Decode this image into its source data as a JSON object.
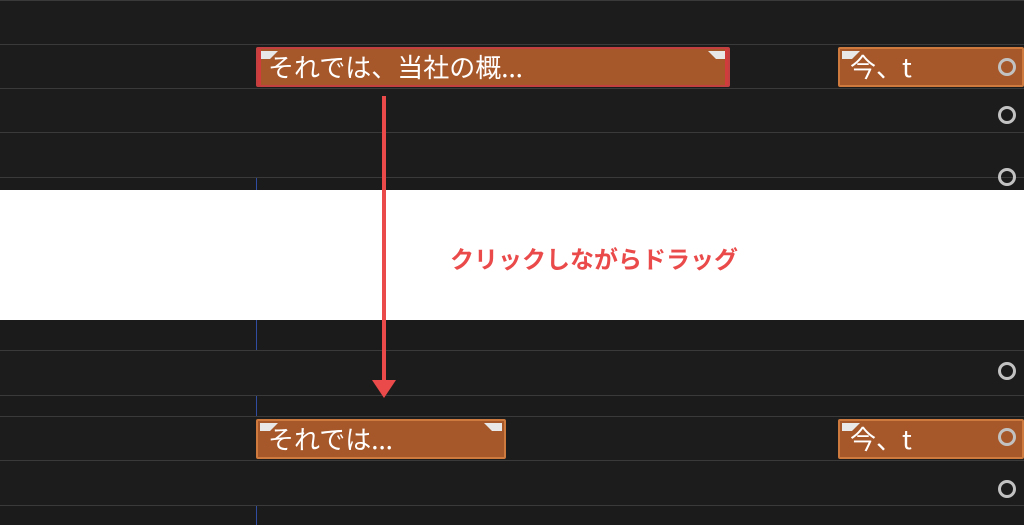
{
  "annotation": {
    "text": "クリックしながらドラッグ"
  },
  "top_timeline": {
    "clipA": {
      "label": "それでは、当社の概..."
    },
    "clipB": {
      "label": "今、t"
    }
  },
  "bottom_timeline": {
    "clipA": {
      "label": "それでは..."
    },
    "clipB": {
      "label": "今、t"
    }
  },
  "colors": {
    "accent_arrow": "#ea4a4a",
    "clip_fill": "#a6582a",
    "clip_border": "#ce7a3f",
    "selection": "#d23b3b",
    "playhead": "#3a5fd0"
  }
}
